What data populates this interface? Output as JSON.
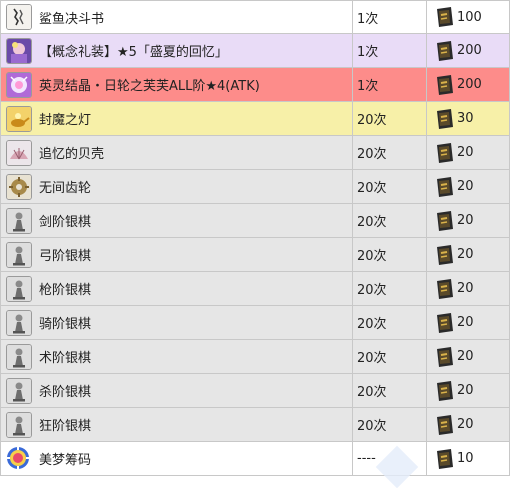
{
  "rows": [
    {
      "name": "鲨鱼决斗书",
      "limit": "1次",
      "price": "100",
      "bg": "#ffffff",
      "icon": "shark-duel-book-icon"
    },
    {
      "name": "【概念礼装】★5「盛夏的回忆」",
      "limit": "1次",
      "price": "200",
      "bg": "#e9dcf7",
      "icon": "craft-essence-icon"
    },
    {
      "name": "英灵结晶・日轮之芙芙ALL阶★4(ATK)",
      "limit": "1次",
      "price": "200",
      "bg": "#fd8c8a",
      "icon": "fou-crystal-icon"
    },
    {
      "name": "封魔之灯",
      "limit": "20次",
      "price": "30",
      "bg": "#f7f0a8",
      "icon": "magic-lamp-icon"
    },
    {
      "name": "追忆的贝壳",
      "limit": "20次",
      "price": "20",
      "bg": "#e6e6e6",
      "icon": "shell-icon"
    },
    {
      "name": "无间齿轮",
      "limit": "20次",
      "price": "20",
      "bg": "#e6e6e6",
      "icon": "gear-icon"
    },
    {
      "name": "剑阶银棋",
      "limit": "20次",
      "price": "20",
      "bg": "#e6e6e6",
      "icon": "saber-silver-piece-icon"
    },
    {
      "name": "弓阶银棋",
      "limit": "20次",
      "price": "20",
      "bg": "#e6e6e6",
      "icon": "archer-silver-piece-icon"
    },
    {
      "name": "枪阶银棋",
      "limit": "20次",
      "price": "20",
      "bg": "#e6e6e6",
      "icon": "lancer-silver-piece-icon"
    },
    {
      "name": "骑阶银棋",
      "limit": "20次",
      "price": "20",
      "bg": "#e6e6e6",
      "icon": "rider-silver-piece-icon"
    },
    {
      "name": "术阶银棋",
      "limit": "20次",
      "price": "20",
      "bg": "#e6e6e6",
      "icon": "caster-silver-piece-icon"
    },
    {
      "name": "杀阶银棋",
      "limit": "20次",
      "price": "20",
      "bg": "#e6e6e6",
      "icon": "assassin-silver-piece-icon"
    },
    {
      "name": "狂阶银棋",
      "limit": "20次",
      "price": "20",
      "bg": "#e6e6e6",
      "icon": "berserker-silver-piece-icon"
    },
    {
      "name": "美梦筹码",
      "limit": "----",
      "price": "10",
      "bg": "#ffffff",
      "icon": "poker-chip-icon"
    }
  ],
  "currency_icon": "ticket-book-icon"
}
